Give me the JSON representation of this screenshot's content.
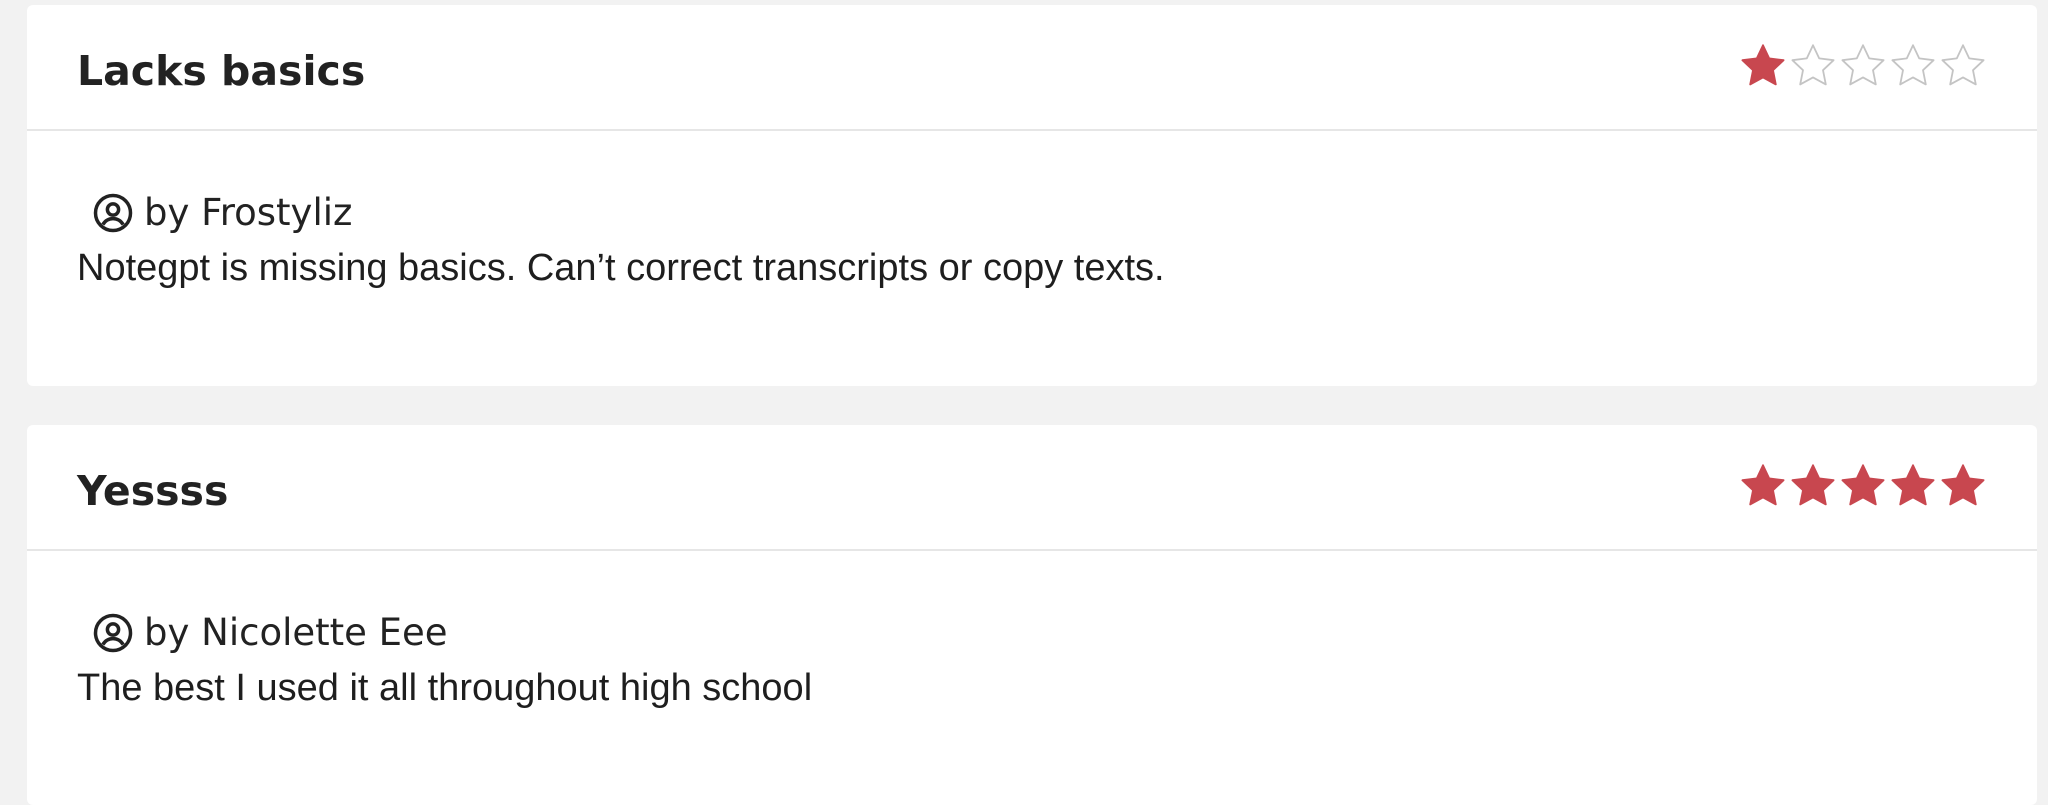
{
  "colors": {
    "star_filled": "#c8474f",
    "star_empty": "#ffffff",
    "text": "#222222"
  },
  "reviews": [
    {
      "title": "Lacks basics",
      "rating": 1,
      "rating_max": 5,
      "author": "by Frostyliz",
      "author_icon": "user-circle-icon",
      "text": "Notegpt is missing basics. Can’t correct transcripts or copy texts."
    },
    {
      "title": "Yessss",
      "rating": 5,
      "rating_max": 5,
      "author": "by Nicolette Eee",
      "author_icon": "user-circle-icon",
      "text": "The best I used it all throughout high school"
    }
  ]
}
